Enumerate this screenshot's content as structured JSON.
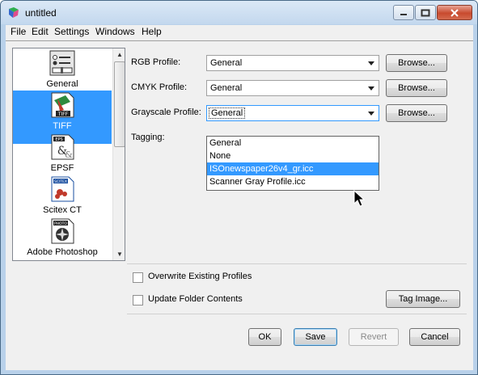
{
  "window": {
    "title": "untitled"
  },
  "menu": [
    "File",
    "Edit",
    "Settings",
    "Windows",
    "Help"
  ],
  "sidebar": {
    "items": [
      {
        "label": "General",
        "icon": "settings-panel-icon"
      },
      {
        "label": "TIFF",
        "icon": "tiff-file-icon",
        "selected": true
      },
      {
        "label": "EPSF",
        "icon": "eps-file-icon"
      },
      {
        "label": "Scitex CT",
        "icon": "scitex-file-icon"
      },
      {
        "label": "Adobe Photoshop",
        "icon": "photoshop-file-icon"
      }
    ]
  },
  "profiles": {
    "rgb": {
      "label": "RGB Profile:",
      "value": "General",
      "browse": "Browse..."
    },
    "cmyk": {
      "label": "CMYK Profile:",
      "value": "General",
      "browse": "Browse..."
    },
    "grayscale": {
      "label": "Grayscale Profile:",
      "value": "General",
      "browse": "Browse..."
    },
    "tagging": {
      "label": "Tagging:"
    }
  },
  "dropdown": {
    "options": [
      "General",
      "None",
      "ISOnewspaper26v4_gr.icc",
      "Scanner Gray Profile.icc"
    ],
    "highlighted_index": 2
  },
  "options": {
    "overwrite": {
      "label": "Overwrite Existing Profiles",
      "checked": false
    },
    "update_folder": {
      "label": "Update Folder Contents",
      "checked": false
    },
    "tag_image": "Tag Image..."
  },
  "footer": {
    "ok": "OK",
    "save": "Save",
    "revert": "Revert",
    "cancel": "Cancel"
  },
  "colors": {
    "selection": "#3399ff",
    "titlebar": "#c3d8ee"
  }
}
